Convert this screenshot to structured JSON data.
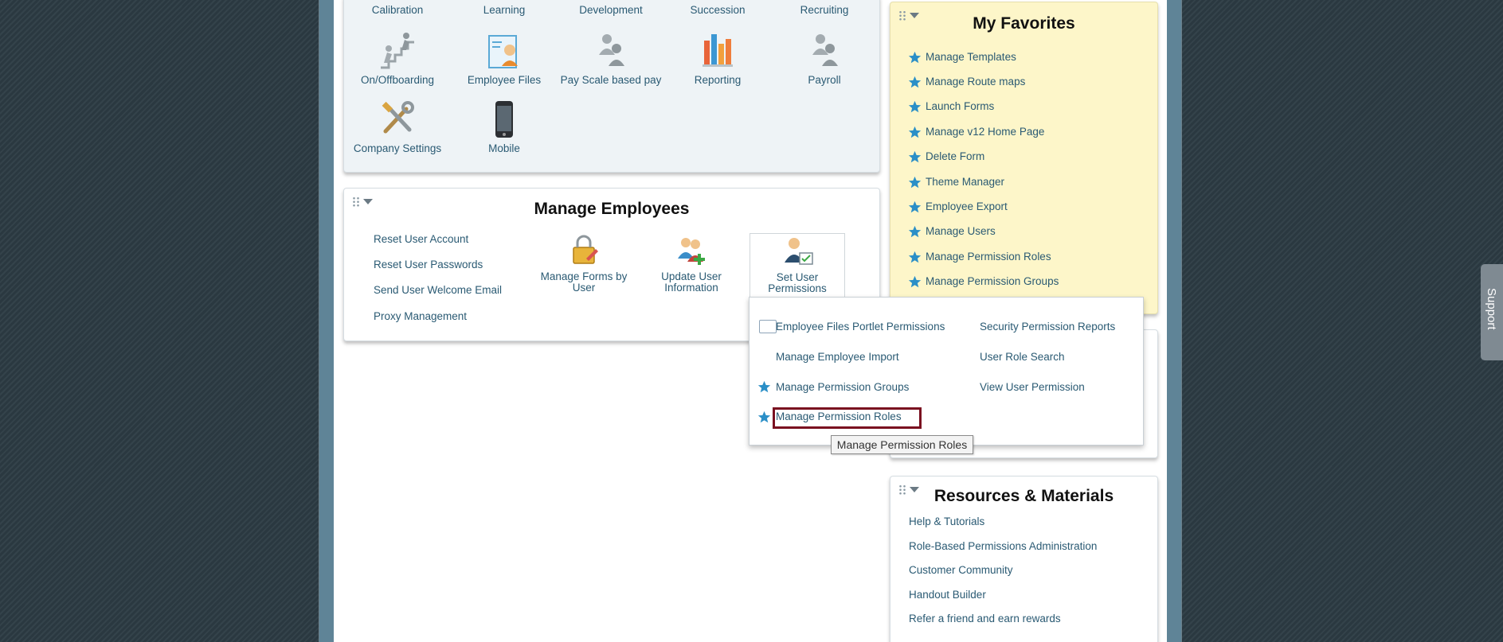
{
  "admin_tiles": {
    "row1": [
      "Calibration",
      "Learning",
      "Development",
      "Succession",
      "Recruiting"
    ],
    "row2": [
      "On/Offboarding",
      "Employee Files",
      "Pay Scale based pay",
      "Reporting",
      "Payroll"
    ],
    "row3": [
      "Company Settings",
      "Mobile"
    ]
  },
  "manage_employees": {
    "title": "Manage Employees",
    "links": [
      "Reset User Account",
      "Reset User Passwords",
      "Send User Welcome Email",
      "Proxy Management"
    ],
    "tiles": [
      "Manage Forms by User",
      "Update User Information",
      "Set User Permissions"
    ]
  },
  "permissions_dropdown": {
    "left": [
      "Employee Files Portlet Permissions",
      "Manage Employee Import",
      "Manage Permission Groups",
      "Manage Permission Roles"
    ],
    "right": [
      "Security Permission Reports",
      "User Role Search",
      "View User Permission"
    ],
    "tooltip": "Manage Permission Roles"
  },
  "favorites": {
    "title": "My Favorites",
    "items": [
      "Manage Templates",
      "Manage Route maps",
      "Launch Forms",
      "Manage v12 Home Page",
      "Delete Form",
      "Theme Manager",
      "Employee Export",
      "Manage Users",
      "Manage Permission Roles",
      "Manage Permission Groups"
    ]
  },
  "resources": {
    "title": "Resources & Materials",
    "items": [
      "Help & Tutorials",
      "Role-Based Permissions Administration",
      "Customer Community",
      "Handout Builder",
      "Refer a friend and earn rewards"
    ]
  },
  "support": {
    "label": "Support"
  },
  "colors": {
    "link": "#2a5a73",
    "favorites_bg": "#fdf6c9",
    "highlight": "#7a1020",
    "star": "#2b8fc7"
  }
}
